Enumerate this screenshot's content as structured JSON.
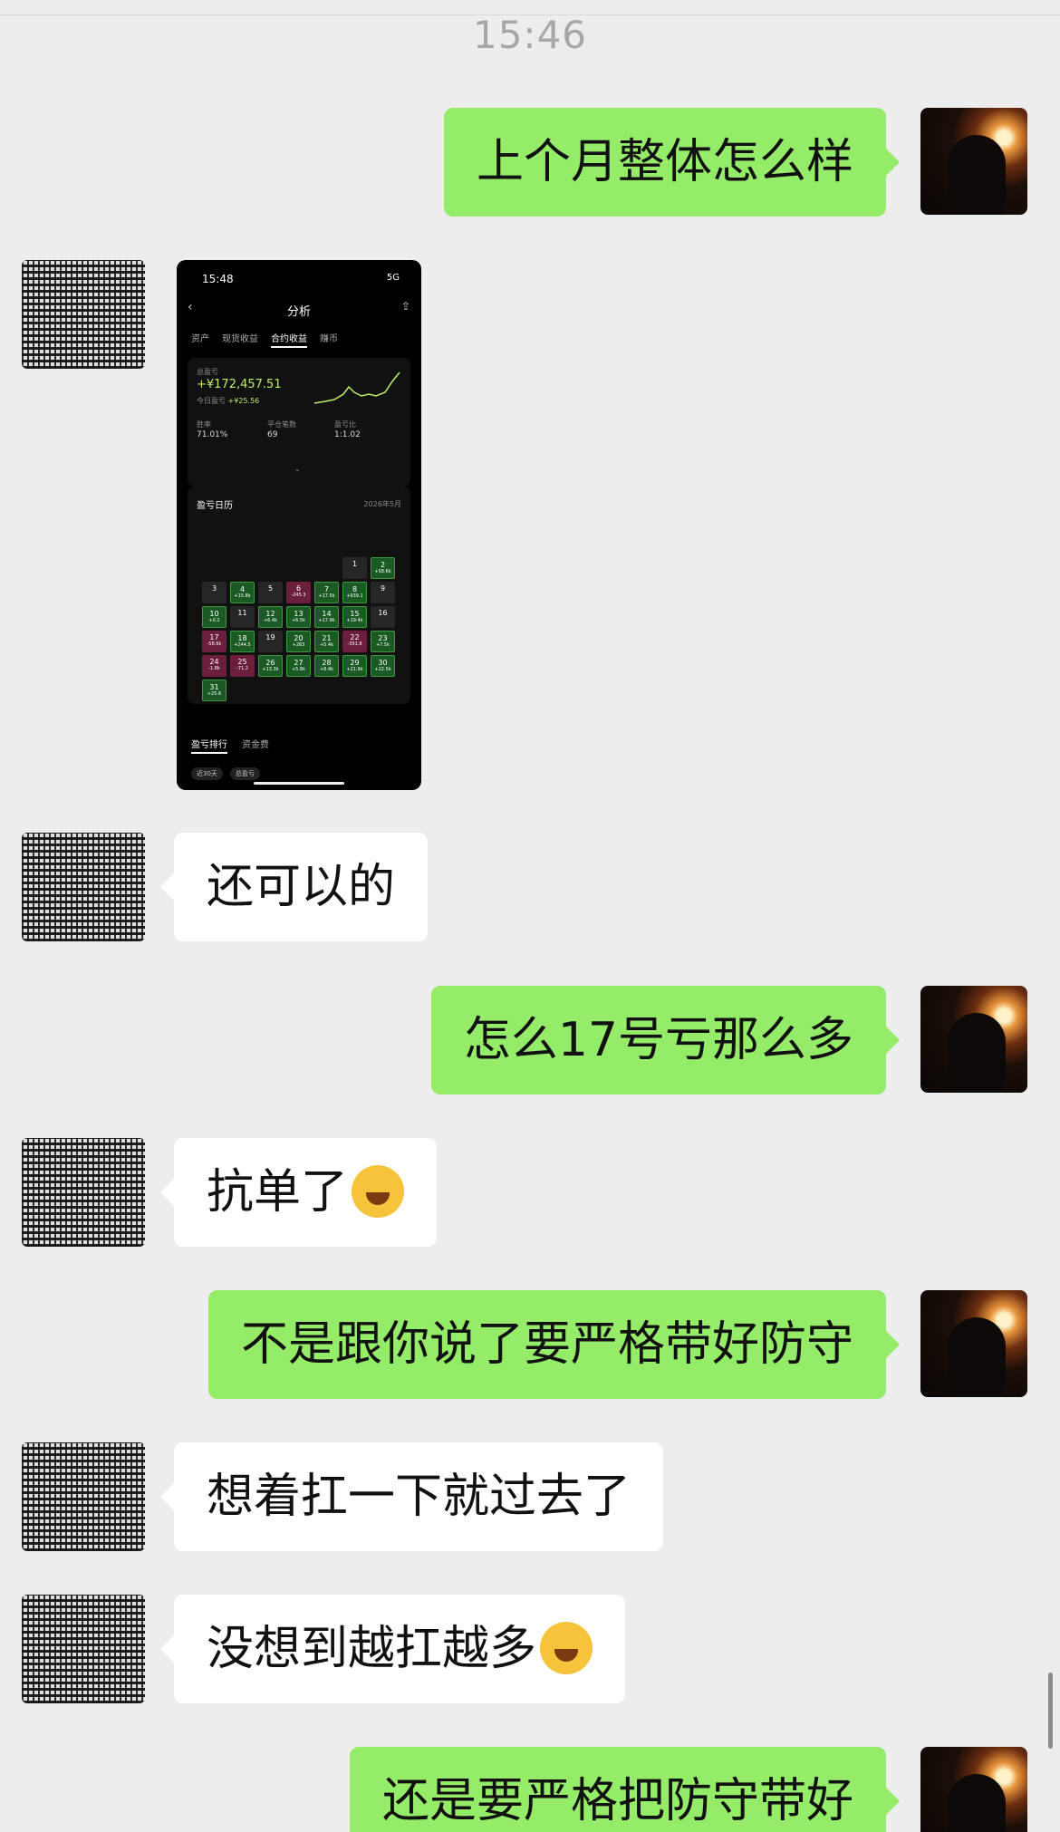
{
  "timestamp": "15:46",
  "messages": {
    "m1": "上个月整体怎么样",
    "m3": "还可以的",
    "m4": "怎么17号亏那么多",
    "m5": "抗单了",
    "m6": "不是跟你说了要严格带好防守",
    "m7": "想着扛一下就过去了",
    "m8": "没想到越扛越多",
    "m9": "还是要严格把防守带好"
  },
  "emoji": "crying-face",
  "colors": {
    "self_bubble": "#95ec69",
    "other_bubble": "#ffffff",
    "background": "#ededed"
  },
  "screenshot": {
    "status_time": "15:48",
    "status_signal": "5G",
    "title": "分析",
    "tabs": [
      "资产",
      "现货收益",
      "合约收益",
      "赚币"
    ],
    "active_tab": "合约收益",
    "total_label": "总盈亏",
    "total_value": "+¥172,457.51",
    "today_label": "今日盈亏",
    "today_value": "+¥25.56",
    "win_rate_label": "胜率",
    "win_rate": "71.01%",
    "trades_label": "平仓笔数",
    "trades": "69",
    "ratio_label": "盈亏比",
    "ratio": "1:1.02",
    "calendar_title": "盈亏日历",
    "calendar_month": "2026年5月",
    "bottom_tabs": [
      "盈亏排行",
      "资金费"
    ],
    "chips": [
      "近30天",
      "总盈亏"
    ],
    "calendar": [
      {
        "day": "1",
        "value": "",
        "tone": "n"
      },
      {
        "day": "2",
        "value": "+58.6k",
        "tone": "g"
      },
      {
        "day": "3",
        "value": "",
        "tone": "n"
      },
      {
        "day": "4",
        "value": "+15.8k",
        "tone": "g"
      },
      {
        "day": "5",
        "value": "",
        "tone": "n"
      },
      {
        "day": "6",
        "value": "-245.3",
        "tone": "r"
      },
      {
        "day": "7",
        "value": "+17.5k",
        "tone": "g"
      },
      {
        "day": "8",
        "value": "+939.1",
        "tone": "g"
      },
      {
        "day": "9",
        "value": "",
        "tone": "n"
      },
      {
        "day": "10",
        "value": "+0.2",
        "tone": "g"
      },
      {
        "day": "11",
        "value": "",
        "tone": "n"
      },
      {
        "day": "12",
        "value": "+6.4k",
        "tone": "g"
      },
      {
        "day": "13",
        "value": "+6.5k",
        "tone": "g"
      },
      {
        "day": "14",
        "value": "+17.9k",
        "tone": "g"
      },
      {
        "day": "15",
        "value": "+19.4k",
        "tone": "g"
      },
      {
        "day": "16",
        "value": "",
        "tone": "n"
      },
      {
        "day": "17",
        "value": "-58.6k",
        "tone": "r"
      },
      {
        "day": "18",
        "value": "+244.5",
        "tone": "g"
      },
      {
        "day": "19",
        "value": "",
        "tone": "n"
      },
      {
        "day": "20",
        "value": "+263",
        "tone": "g"
      },
      {
        "day": "21",
        "value": "+5.4k",
        "tone": "g"
      },
      {
        "day": "22",
        "value": "-391.8",
        "tone": "r"
      },
      {
        "day": "23",
        "value": "+7.5k",
        "tone": "g"
      },
      {
        "day": "24",
        "value": "-1.8k",
        "tone": "r"
      },
      {
        "day": "25",
        "value": "-71.2",
        "tone": "r"
      },
      {
        "day": "26",
        "value": "+13.3k",
        "tone": "g"
      },
      {
        "day": "27",
        "value": "+5.8k",
        "tone": "g"
      },
      {
        "day": "28",
        "value": "+8.4k",
        "tone": "g"
      },
      {
        "day": "29",
        "value": "+21.9k",
        "tone": "g"
      },
      {
        "day": "30",
        "value": "+22.5k",
        "tone": "g"
      },
      {
        "day": "31",
        "value": "+25.6",
        "tone": "g"
      }
    ]
  }
}
